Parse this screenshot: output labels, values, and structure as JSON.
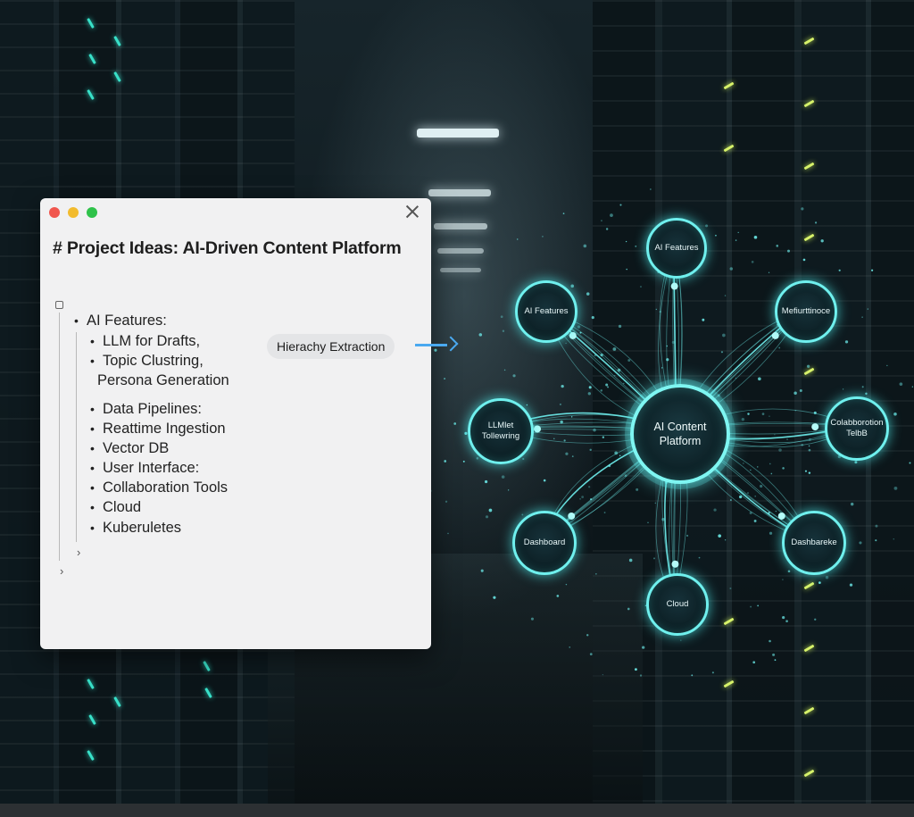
{
  "window": {
    "title": "# Project Ideas: AI-Driven Content Platform",
    "items": [
      "AI Features:",
      "LLM for Drafts,",
      "Topic Clustring,",
      "Persona Generation",
      "Data Pipelines:",
      "Reattime Ingestion",
      "Vector DB",
      "User Interface:",
      "Collaboration Tools",
      "Cloud",
      "Kuberuletes"
    ]
  },
  "callout": {
    "label": "Hierachy Extraction",
    "arrow_color": "#4aa9f0"
  },
  "mindmap": {
    "center": "AI Content Platform",
    "nodes": [
      "AI Features",
      "AI Features",
      "Mefiurttinoce",
      "LLMlet Tollewring",
      "Colabborotion TelbB",
      "Dashboard",
      "Dashbareke",
      "Cloud"
    ],
    "accent_color": "#6ff0ee"
  },
  "icons": {
    "close": "close-icon",
    "checkbox": "checkbox-icon",
    "collapse": "chevron-right-icon"
  }
}
